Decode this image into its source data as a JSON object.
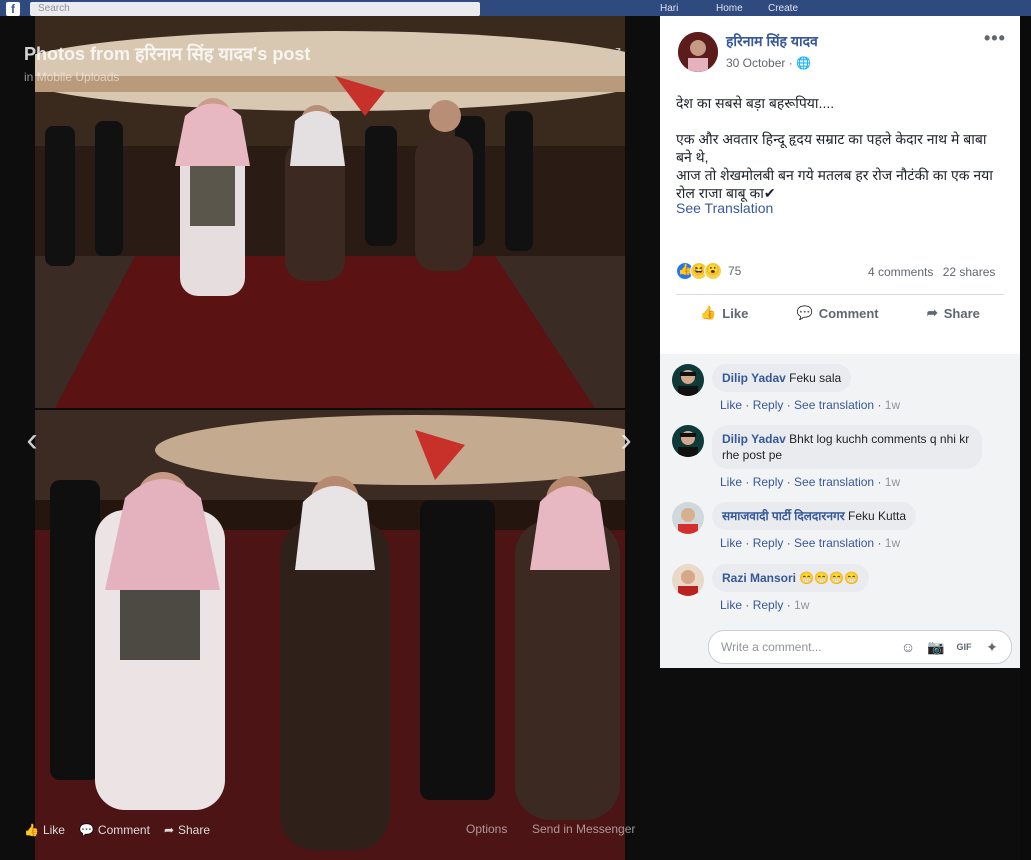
{
  "topbar": {
    "search_placeholder": "Search",
    "nav": [
      "Hari",
      "Home",
      "Create"
    ]
  },
  "viewer": {
    "title": "Photos from हरिनाम सिंह यादव's post",
    "subtitle": "in Mobile Uploads",
    "actions": {
      "like": "Like",
      "comment": "Comment",
      "share": "Share"
    },
    "options": "Options",
    "send": "Send in Messenger"
  },
  "post": {
    "author": "हरिनाम सिंह यादव",
    "date": "30 October",
    "privacy_icon": "globe-icon",
    "more": "•••",
    "line1": "देश का सबसे बड़ा बहरूपिया....",
    "line2": "एक और अवतार हिन्दू हृदय सम्राट का पहले केदार नाथ मे बाबा बने थे,",
    "line3": "आज तो शेखमोलबी बन गये मतलब हर रोज नौटंकी का एक नया रोल राजा बाबू का✔",
    "see_translation": "See Translation",
    "reaction_count": "75",
    "comments": "4 comments",
    "shares": "22 shares",
    "actions": {
      "like": "Like",
      "comment": "Comment",
      "share": "Share"
    }
  },
  "comments": [
    {
      "name": "Dilip Yadav",
      "text": "Feku sala",
      "like": "Like",
      "reply": "Reply",
      "translate": "See translation",
      "time": "1w"
    },
    {
      "name": "Dilip Yadav",
      "text": "Bhkt log kuchh comments q nhi kr rhe post pe",
      "like": "Like",
      "reply": "Reply",
      "translate": "See translation",
      "time": "1w"
    },
    {
      "name": "समाजवादी पार्टी दिलदारनगर",
      "text": "Feku Kutta",
      "like": "Like",
      "reply": "Reply",
      "translate": "See translation",
      "time": "1w"
    },
    {
      "name": "Razi Mansori",
      "text": "😁😁😁😁",
      "like": "Like",
      "reply": "Reply",
      "time": "1w"
    }
  ],
  "composer": {
    "placeholder": "Write a comment..."
  },
  "colors": {
    "link": "#365899",
    "fb_blue": "#3b5998",
    "carpet": "#5a1212"
  }
}
